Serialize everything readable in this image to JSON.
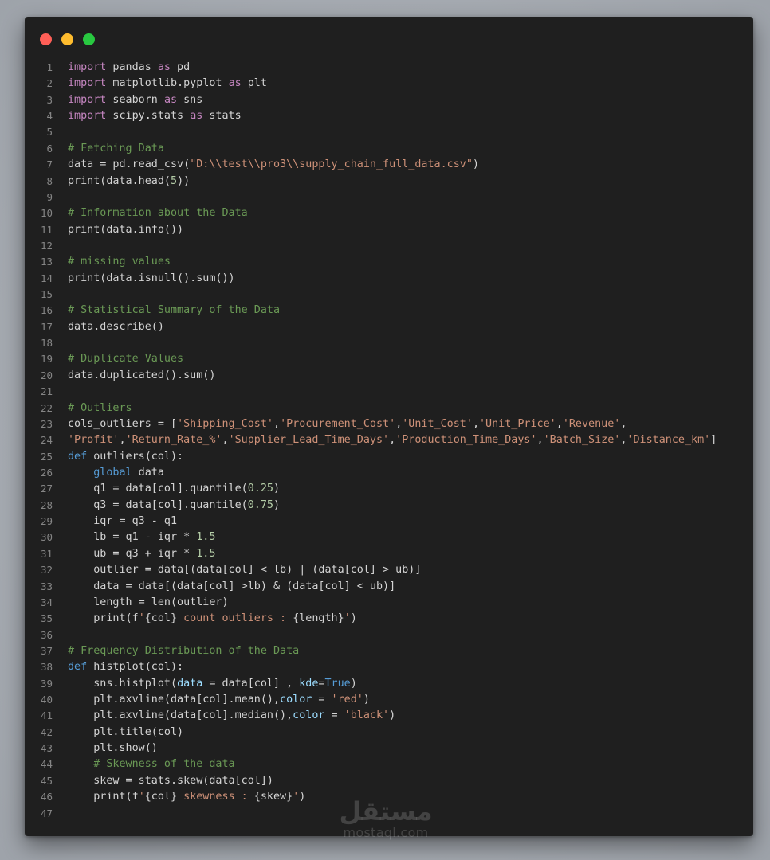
{
  "window": {
    "controls": [
      {
        "name": "close",
        "color": "#ff5f57"
      },
      {
        "name": "minimize",
        "color": "#febc2e"
      },
      {
        "name": "maximize",
        "color": "#28c840"
      }
    ]
  },
  "colors": {
    "background": "#1f1f1f",
    "keyword": "#c586c0",
    "def": "#569cd6",
    "string": "#ce9178",
    "comment": "#6a9955",
    "number": "#b5cea8",
    "param": "#9cdcfe",
    "text": "#d4d4d4",
    "line_number": "#858585"
  },
  "code": {
    "lines": [
      [
        {
          "t": "kw",
          "v": "import"
        },
        {
          "t": "pl",
          "v": " pandas "
        },
        {
          "t": "kw",
          "v": "as"
        },
        {
          "t": "pl",
          "v": " pd"
        }
      ],
      [
        {
          "t": "kw",
          "v": "import"
        },
        {
          "t": "pl",
          "v": " matplotlib.pyplot "
        },
        {
          "t": "kw",
          "v": "as"
        },
        {
          "t": "pl",
          "v": " plt"
        }
      ],
      [
        {
          "t": "kw",
          "v": "import"
        },
        {
          "t": "pl",
          "v": " seaborn "
        },
        {
          "t": "kw",
          "v": "as"
        },
        {
          "t": "pl",
          "v": " sns"
        }
      ],
      [
        {
          "t": "kw",
          "v": "import"
        },
        {
          "t": "pl",
          "v": " scipy.stats "
        },
        {
          "t": "kw",
          "v": "as"
        },
        {
          "t": "pl",
          "v": " stats"
        }
      ],
      [],
      [
        {
          "t": "cm",
          "v": "# Fetching Data"
        }
      ],
      [
        {
          "t": "pl",
          "v": "data = pd.read_csv("
        },
        {
          "t": "st",
          "v": "\"D:\\\\test\\\\pro3\\\\supply_chain_full_data.csv\""
        },
        {
          "t": "pl",
          "v": ")"
        }
      ],
      [
        {
          "t": "pl",
          "v": "print(data.head("
        },
        {
          "t": "nm",
          "v": "5"
        },
        {
          "t": "pl",
          "v": "))"
        }
      ],
      [],
      [
        {
          "t": "cm",
          "v": "# Information about the Data"
        }
      ],
      [
        {
          "t": "pl",
          "v": "print(data.info())"
        }
      ],
      [],
      [
        {
          "t": "cm",
          "v": "# missing values"
        }
      ],
      [
        {
          "t": "pl",
          "v": "print(data.isnull().sum())"
        }
      ],
      [],
      [
        {
          "t": "cm",
          "v": "# Statistical Summary of the Data"
        }
      ],
      [
        {
          "t": "pl",
          "v": "data.describe()"
        }
      ],
      [],
      [
        {
          "t": "cm",
          "v": "# Duplicate Values"
        }
      ],
      [
        {
          "t": "pl",
          "v": "data.duplicated().sum()"
        }
      ],
      [],
      [
        {
          "t": "cm",
          "v": "# Outliers"
        }
      ],
      [
        {
          "t": "pl",
          "v": "cols_outliers = ["
        },
        {
          "t": "st",
          "v": "'Shipping_Cost'"
        },
        {
          "t": "pl",
          "v": ","
        },
        {
          "t": "st",
          "v": "'Procurement_Cost'"
        },
        {
          "t": "pl",
          "v": ","
        },
        {
          "t": "st",
          "v": "'Unit_Cost'"
        },
        {
          "t": "pl",
          "v": ","
        },
        {
          "t": "st",
          "v": "'Unit_Price'"
        },
        {
          "t": "pl",
          "v": ","
        },
        {
          "t": "st",
          "v": "'Revenue'"
        },
        {
          "t": "pl",
          "v": ","
        }
      ],
      [
        {
          "t": "st",
          "v": "'Profit'"
        },
        {
          "t": "pl",
          "v": ","
        },
        {
          "t": "st",
          "v": "'Return_Rate_%'"
        },
        {
          "t": "pl",
          "v": ","
        },
        {
          "t": "st",
          "v": "'Supplier_Lead_Time_Days'"
        },
        {
          "t": "pl",
          "v": ","
        },
        {
          "t": "st",
          "v": "'Production_Time_Days'"
        },
        {
          "t": "pl",
          "v": ","
        },
        {
          "t": "st",
          "v": "'Batch_Size'"
        },
        {
          "t": "pl",
          "v": ","
        },
        {
          "t": "st",
          "v": "'Distance_km'"
        },
        {
          "t": "pl",
          "v": "]"
        }
      ],
      [
        {
          "t": "df",
          "v": "def"
        },
        {
          "t": "pl",
          "v": " outliers(col):"
        }
      ],
      [
        {
          "t": "pl",
          "v": "    "
        },
        {
          "t": "df",
          "v": "global"
        },
        {
          "t": "pl",
          "v": " data"
        }
      ],
      [
        {
          "t": "pl",
          "v": "    q1 = data[col].quantile("
        },
        {
          "t": "nm",
          "v": "0.25"
        },
        {
          "t": "pl",
          "v": ")"
        }
      ],
      [
        {
          "t": "pl",
          "v": "    q3 = data[col].quantile("
        },
        {
          "t": "nm",
          "v": "0.75"
        },
        {
          "t": "pl",
          "v": ")"
        }
      ],
      [
        {
          "t": "pl",
          "v": "    iqr = q3 - q1"
        }
      ],
      [
        {
          "t": "pl",
          "v": "    lb = q1 - iqr * "
        },
        {
          "t": "nm",
          "v": "1.5"
        }
      ],
      [
        {
          "t": "pl",
          "v": "    ub = q3 + iqr * "
        },
        {
          "t": "nm",
          "v": "1.5"
        }
      ],
      [
        {
          "t": "pl",
          "v": "    outlier = data[(data[col] < lb) | (data[col] > ub)]"
        }
      ],
      [
        {
          "t": "pl",
          "v": "    data = data[(data[col] >lb) & (data[col] < ub)]"
        }
      ],
      [
        {
          "t": "pl",
          "v": "    length = len(outlier)"
        }
      ],
      [
        {
          "t": "pl",
          "v": "    print(f"
        },
        {
          "t": "st",
          "v": "'"
        },
        {
          "t": "pl",
          "v": "{col}"
        },
        {
          "t": "st",
          "v": " count outliers : "
        },
        {
          "t": "pl",
          "v": "{length}"
        },
        {
          "t": "st",
          "v": "'"
        },
        {
          "t": "pl",
          "v": ")"
        }
      ],
      [],
      [
        {
          "t": "cm",
          "v": "# Frequency Distribution of the Data"
        }
      ],
      [
        {
          "t": "df",
          "v": "def"
        },
        {
          "t": "pl",
          "v": " histplot(col):"
        }
      ],
      [
        {
          "t": "pl",
          "v": "    sns.histplot("
        },
        {
          "t": "pr",
          "v": "data"
        },
        {
          "t": "pl",
          "v": " = data[col] , "
        },
        {
          "t": "pr",
          "v": "kde"
        },
        {
          "t": "pl",
          "v": "="
        },
        {
          "t": "df",
          "v": "True"
        },
        {
          "t": "pl",
          "v": ")"
        }
      ],
      [
        {
          "t": "pl",
          "v": "    plt.axvline(data[col].mean(),"
        },
        {
          "t": "pr",
          "v": "color"
        },
        {
          "t": "pl",
          "v": " = "
        },
        {
          "t": "st",
          "v": "'red'"
        },
        {
          "t": "pl",
          "v": ")"
        }
      ],
      [
        {
          "t": "pl",
          "v": "    plt.axvline(data[col].median(),"
        },
        {
          "t": "pr",
          "v": "color"
        },
        {
          "t": "pl",
          "v": " = "
        },
        {
          "t": "st",
          "v": "'black'"
        },
        {
          "t": "pl",
          "v": ")"
        }
      ],
      [
        {
          "t": "pl",
          "v": "    plt.title(col)"
        }
      ],
      [
        {
          "t": "pl",
          "v": "    plt.show()"
        }
      ],
      [
        {
          "t": "pl",
          "v": "    "
        },
        {
          "t": "cm",
          "v": "# Skewness of the data"
        }
      ],
      [
        {
          "t": "pl",
          "v": "    skew = stats.skew(data[col])"
        }
      ],
      [
        {
          "t": "pl",
          "v": "    print(f"
        },
        {
          "t": "st",
          "v": "'"
        },
        {
          "t": "pl",
          "v": "{col}"
        },
        {
          "t": "st",
          "v": " skewness : "
        },
        {
          "t": "pl",
          "v": "{skew}"
        },
        {
          "t": "st",
          "v": "'"
        },
        {
          "t": "pl",
          "v": ")"
        }
      ],
      []
    ]
  },
  "watermark": {
    "arabic": "مستقل",
    "latin": "mostaql.com"
  }
}
